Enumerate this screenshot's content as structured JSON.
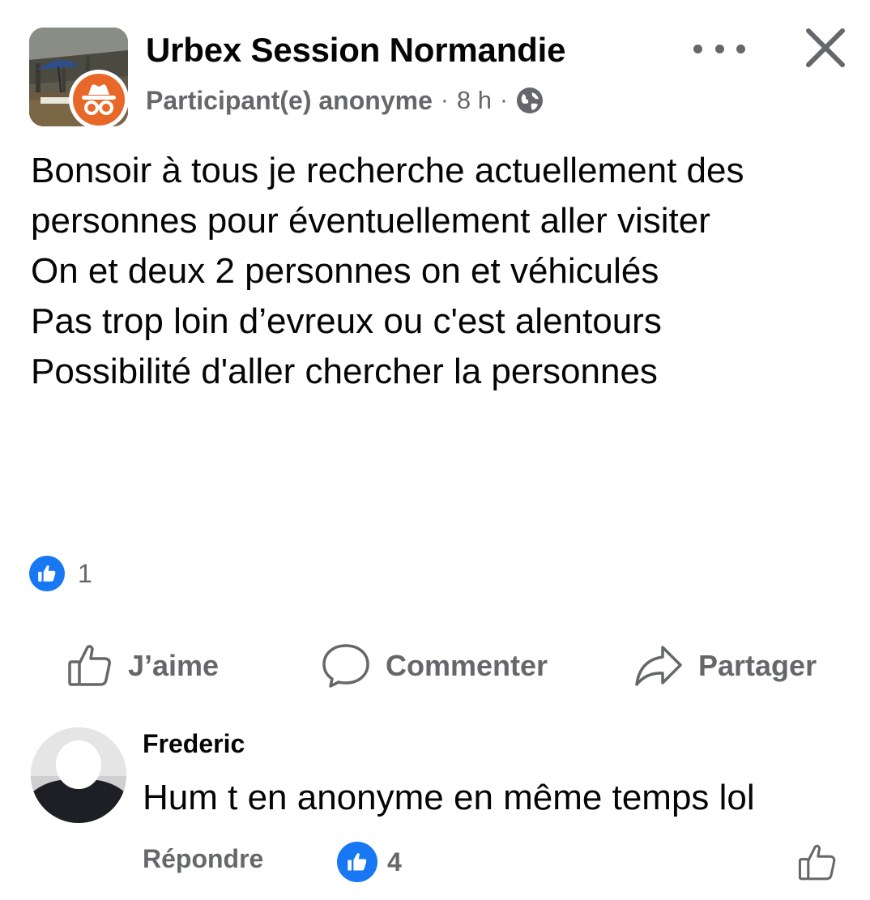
{
  "header": {
    "group_name": "Urbex Session Normandie",
    "author": "Participant(e) anonyme",
    "separator": "·",
    "time_ago": "8 h",
    "privacy_icon": "globe-icon",
    "more_icon": "more-dots-icon",
    "close_icon": "close-icon",
    "badge_color": "#e8682a"
  },
  "post": {
    "lines": [
      "Bonsoir à tous je recherche actuellement des",
      "personnes pour éventuellement aller visiter",
      "On et deux 2 personnes on et véhiculés",
      "Pas trop loin d’evreux ou c'est alentours",
      "Possibilité d'aller chercher la personnes"
    ]
  },
  "reactions": {
    "icon": "like-reaction-icon",
    "count": "1"
  },
  "actions": {
    "like_label": "J’aime",
    "comment_label": "Commenter",
    "share_label": "Partager"
  },
  "comment": {
    "author": "Frederic",
    "text": "Hum t en anonyme en même temps lol",
    "reply_label": "Répondre",
    "reaction_count": "4"
  },
  "colors": {
    "accent": "#1877f2",
    "secondary_text": "#65676b",
    "primary_text": "#050505"
  }
}
